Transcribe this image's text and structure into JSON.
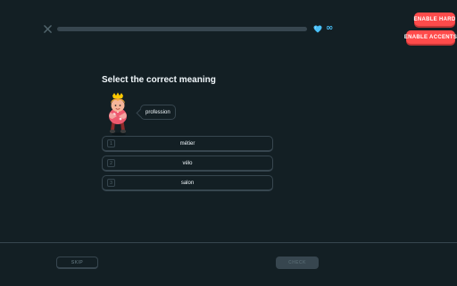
{
  "header": {
    "progress_fraction": 0,
    "hearts_count": "∞",
    "heart_icon": "heart-icon",
    "close_icon": "close-icon"
  },
  "side_buttons": {
    "enable_hard": "ENABLE HARD",
    "enable_accents": "ENABLE ACCENTS"
  },
  "challenge": {
    "title": "Select the correct meaning",
    "prompt_word": "profession",
    "character": "character-illustration",
    "choices": [
      {
        "number": "1",
        "text": "métier"
      },
      {
        "number": "2",
        "text": "vélo"
      },
      {
        "number": "3",
        "text": "salon"
      }
    ]
  },
  "footer": {
    "skip_label": "SKIP",
    "check_label": "CHECK"
  },
  "colors": {
    "background": "#131f24",
    "accent_red": "#ff4b4b",
    "heart_blue": "#49c0f8",
    "border": "#37464f"
  }
}
